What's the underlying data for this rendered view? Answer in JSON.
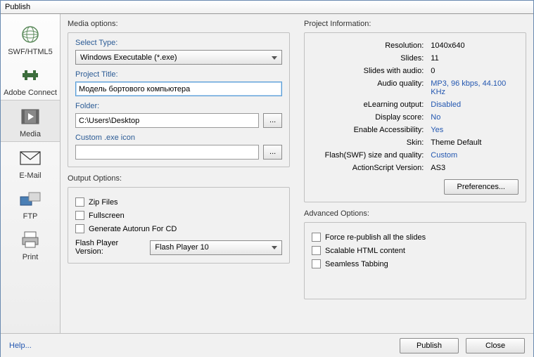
{
  "window": {
    "title": "Publish"
  },
  "sidebar": {
    "items": [
      {
        "label": "SWF/HTML5"
      },
      {
        "label": "Adobe Connect"
      },
      {
        "label": "Media"
      },
      {
        "label": "E-Mail"
      },
      {
        "label": "FTP"
      },
      {
        "label": "Print"
      }
    ]
  },
  "media": {
    "header": "Media options:",
    "select_type_label": "Select Type:",
    "select_type_value": "Windows Executable (*.exe)",
    "project_title_label": "Project Title:",
    "project_title_value": "Модель бортового компьютера",
    "folder_label": "Folder:",
    "folder_value": "C:\\Users\\Desktop",
    "icon_label": "Custom .exe icon",
    "icon_value": "",
    "browse": "..."
  },
  "output": {
    "header": "Output Options:",
    "zip": "Zip Files",
    "fullscreen": "Fullscreen",
    "autorun": "Generate Autorun For CD",
    "flash_label": "Flash Player Version:",
    "flash_value": "Flash Player 10"
  },
  "project_info": {
    "header": "Project Information:",
    "rows": {
      "resolution_l": "Resolution:",
      "resolution_v": "1040x640",
      "slides_l": "Slides:",
      "slides_v": "11",
      "slides_audio_l": "Slides with audio:",
      "slides_audio_v": "0",
      "audio_l": "Audio quality:",
      "audio_v": "MP3, 96 kbps, 44.100 KHz",
      "elearn_l": "eLearning output:",
      "elearn_v": "Disabled",
      "score_l": "Display score:",
      "score_v": "No",
      "access_l": "Enable Accessibility:",
      "access_v": "Yes",
      "skin_l": "Skin:",
      "skin_v": "Theme Default",
      "flashsize_l": "Flash(SWF) size and quality:",
      "flashsize_v": "Custom",
      "as_l": "ActionScript Version:",
      "as_v": "AS3"
    },
    "preferences": "Preferences..."
  },
  "advanced": {
    "header": "Advanced Options:",
    "force": "Force re-publish all the slides",
    "scalable": "Scalable HTML content",
    "seamless": "Seamless Tabbing"
  },
  "footer": {
    "help": "Help...",
    "publish": "Publish",
    "close": "Close"
  }
}
